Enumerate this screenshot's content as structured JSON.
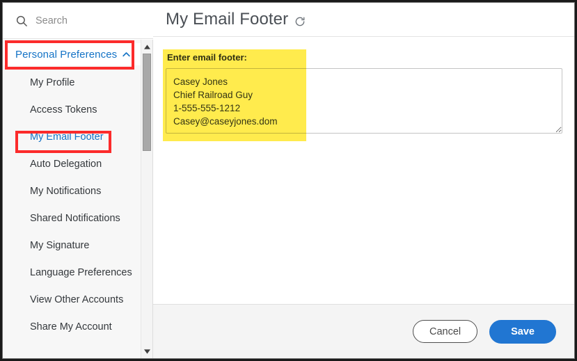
{
  "window": {
    "frame_color": "#1a1a1a"
  },
  "search": {
    "placeholder": "Search",
    "value": "",
    "icon": "search-icon"
  },
  "sidebar": {
    "group": {
      "label": "Personal Preferences",
      "expanded": true,
      "chevron_icon": "chevron-up-icon",
      "color": "#1473c6"
    },
    "items": [
      {
        "label": "My Profile",
        "selected": false
      },
      {
        "label": "Access Tokens",
        "selected": false
      },
      {
        "label": "My Email Footer",
        "selected": true
      },
      {
        "label": "Auto Delegation",
        "selected": false
      },
      {
        "label": "My Notifications",
        "selected": false
      },
      {
        "label": "Shared Notifications",
        "selected": false
      },
      {
        "label": "My Signature",
        "selected": false
      },
      {
        "label": "Language Preferences",
        "selected": false
      },
      {
        "label": "View Other Accounts",
        "selected": false
      },
      {
        "label": "Share My Account",
        "selected": false
      }
    ],
    "scrollbar": {
      "up_arrow_icon": "caret-up-icon",
      "down_arrow_icon": "caret-down-icon"
    }
  },
  "header": {
    "title": "My Email Footer",
    "refresh_icon": "refresh-icon"
  },
  "form": {
    "field_label": "Enter email footer:",
    "footer_value": "Casey Jones\nChief Railroad Guy\n1-555-555-1212\nCasey@caseyjones.dom",
    "footer_placeholder": "",
    "resize_handle_icon": "resize-handle-icon"
  },
  "actions": {
    "cancel_label": "Cancel",
    "save_label": "Save",
    "save_color": "#2176d2"
  },
  "annotations": {
    "highlight_color": "#ffeb4d",
    "box_color": "#fc2b2b",
    "boxes": [
      {
        "target": "Personal Preferences"
      },
      {
        "target": "My Email Footer"
      }
    ]
  }
}
